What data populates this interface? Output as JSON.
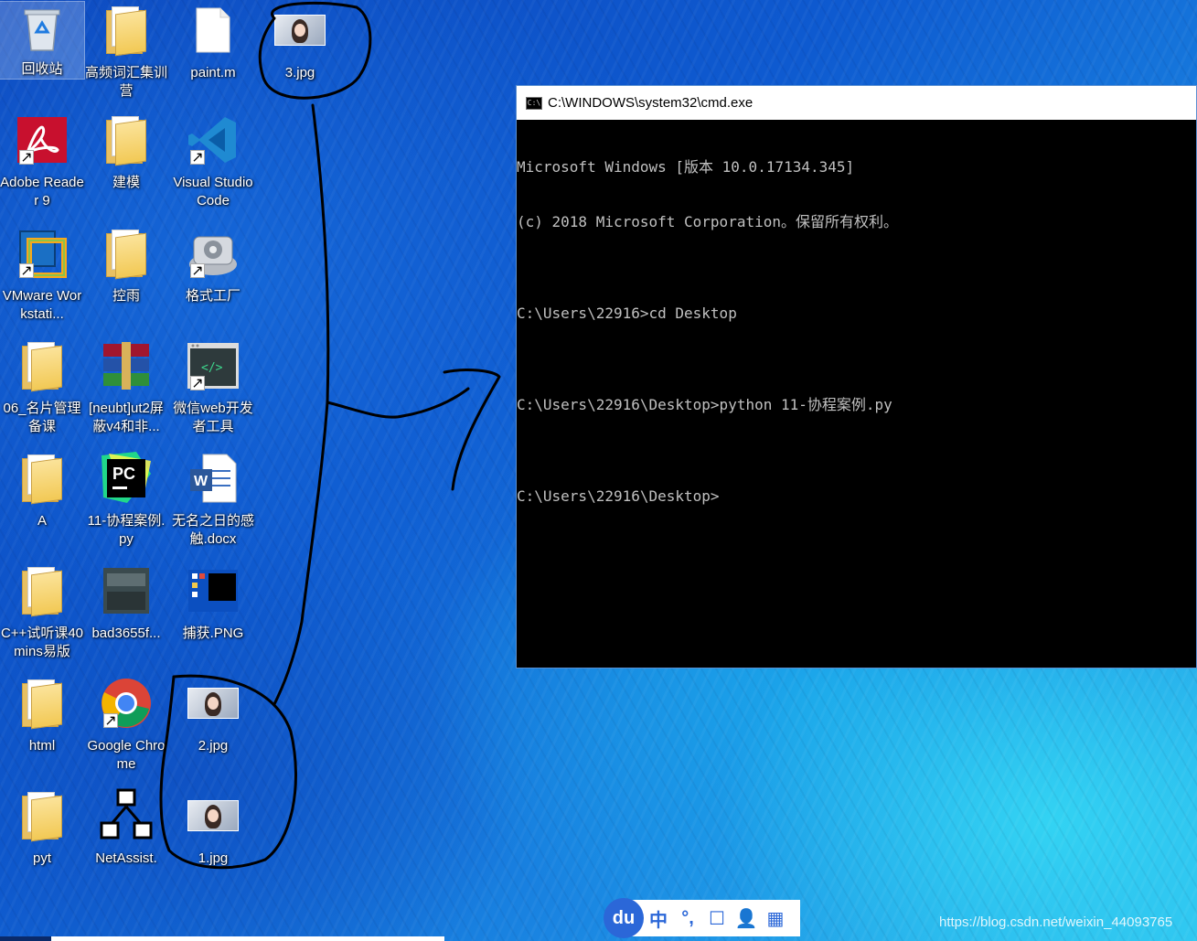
{
  "desktop": {
    "icons": [
      {
        "label": "回收站",
        "type": "recycle"
      },
      {
        "label": "高频词汇集训营",
        "type": "folder-doc"
      },
      {
        "label": "paint.m",
        "type": "file"
      },
      {
        "label": "3.jpg",
        "type": "image"
      },
      {
        "label": "Adobe Reader 9",
        "type": "adobe"
      },
      {
        "label": "建模",
        "type": "folder"
      },
      {
        "label": "Visual Studio Code",
        "type": "vscode"
      },
      {
        "label": "VMware Workstati...",
        "type": "vmware"
      },
      {
        "label": "控雨",
        "type": "folder"
      },
      {
        "label": "格式工厂",
        "type": "formatfactory"
      },
      {
        "label": "06_名片管理备课",
        "type": "folder-pc"
      },
      {
        "label": "[neubt]ut2屏蔽v4和非...",
        "type": "winrar"
      },
      {
        "label": "微信web开发者工具",
        "type": "wechat-dev"
      },
      {
        "label": "A",
        "type": "folder"
      },
      {
        "label": "11-协程案例.py",
        "type": "pycharm"
      },
      {
        "label": "无名之日的感触.docx",
        "type": "word"
      },
      {
        "label": "C++试听课40mins易版",
        "type": "folder"
      },
      {
        "label": "bad3655f...",
        "type": "screenshot-dark"
      },
      {
        "label": "捕获.PNG",
        "type": "screenshot"
      },
      {
        "label": "html",
        "type": "folder"
      },
      {
        "label": "Google Chrome",
        "type": "chrome"
      },
      {
        "label": "2.jpg",
        "type": "image"
      },
      {
        "label": "pyt",
        "type": "folder"
      },
      {
        "label": "NetAssist.",
        "type": "netassist"
      },
      {
        "label": "1.jpg",
        "type": "image"
      }
    ]
  },
  "cmd_window": {
    "title": "C:\\WINDOWS\\system32\\cmd.exe",
    "icon_text": "C:\\",
    "lines": [
      "Microsoft Windows [版本 10.0.17134.345]",
      "(c) 2018 Microsoft Corporation。保留所有权利。",
      "",
      "C:\\Users\\22916>cd Desktop",
      "",
      "C:\\Users\\22916\\Desktop>python 11-协程案例.py",
      "",
      "C:\\Users\\22916\\Desktop>"
    ]
  },
  "ime_bar": {
    "logo": "du",
    "mode": "中",
    "punct": "°,",
    "items": [
      "中",
      "°,",
      "☐",
      "👤",
      "▦"
    ]
  },
  "watermark": "https://blog.csdn.net/weixin_44093765"
}
